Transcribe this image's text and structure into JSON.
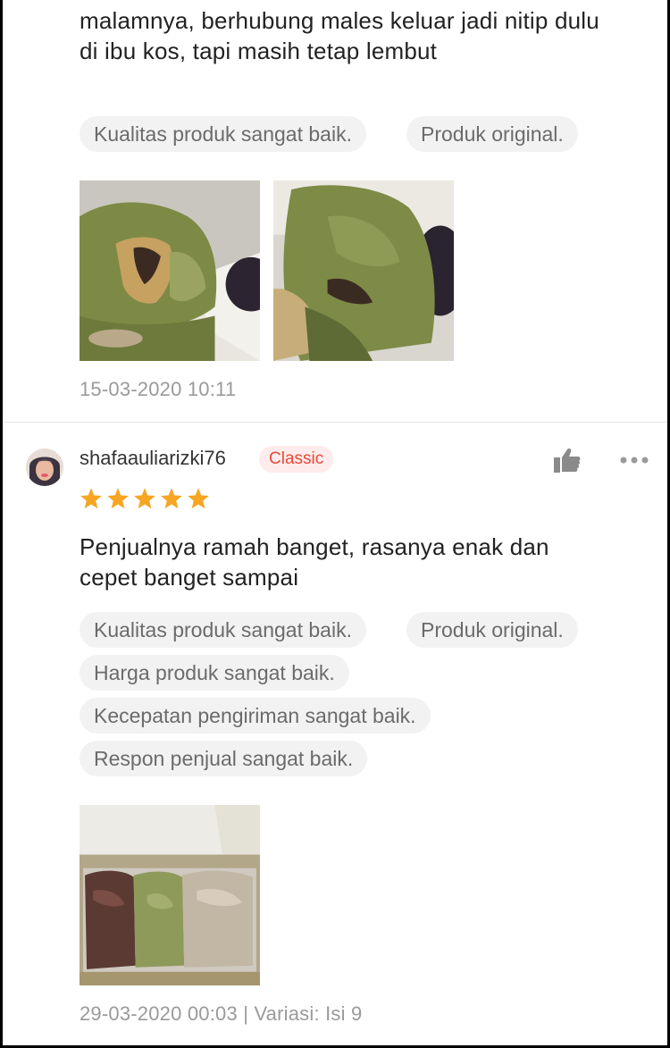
{
  "review1": {
    "text_line1": "malamnya, berhubung males keluar jadi nitip dulu",
    "text_line2": "di ibu kos, tapi masih tetap lembut",
    "tags": [
      "Kualitas produk sangat baik.",
      "Produk original."
    ],
    "photos": [
      "matcha-bread-photo-1",
      "matcha-bread-photo-2"
    ],
    "timestamp": "15-03-2020 10:11"
  },
  "review2": {
    "username": "shafaauliarizki76",
    "badge": "Classic",
    "rating": 5,
    "text_line1": "Penjualnya ramah banget, rasanya enak dan",
    "text_line2": "cepet banget sampai",
    "tags": [
      "Kualitas produk sangat baik.",
      "Produk original.",
      "Harga produk sangat baik.",
      "Kecepatan pengiriman sangat baik.",
      "Respon penjual sangat baik."
    ],
    "photos": [
      "bread-box-photo"
    ],
    "footer": "29-03-2020 00:03 | Variasi: Isi 9"
  },
  "icons": {
    "like": "thumbs-up-icon",
    "more": "more-dots-icon",
    "star": "star-icon"
  },
  "colors": {
    "badge_text": "#e84a3c",
    "badge_bg": "#fdeceb",
    "star": "#f6a623",
    "tag_bg": "#f2f2f2"
  }
}
